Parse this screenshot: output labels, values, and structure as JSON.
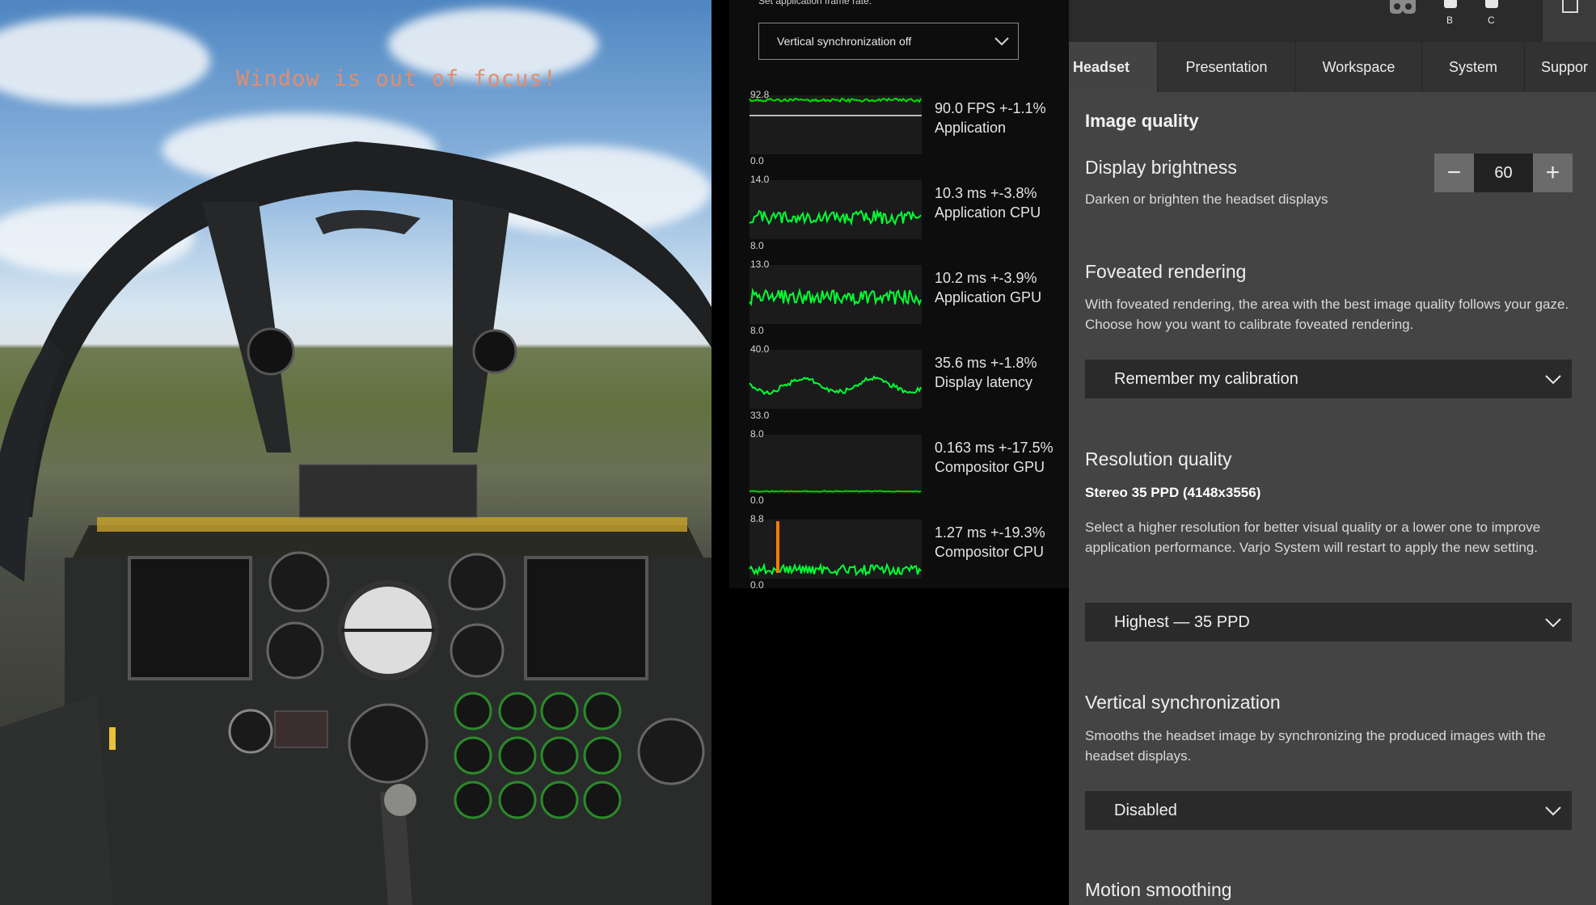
{
  "game": {
    "focus_message": "Window is out of focus!"
  },
  "stats": {
    "frame_rate_label": "Set application frame rate:",
    "frame_rate_select": "Vertical synchronization off",
    "graphs": [
      {
        "top": "92.8",
        "bottom": "0.0",
        "value": "90.0 FPS +-1.1%",
        "name": "Application",
        "color": "#00e000"
      },
      {
        "top": "14.0",
        "bottom": "8.0",
        "value": "10.3 ms +-3.8%",
        "name": "Application CPU",
        "color": "#00ff33"
      },
      {
        "top": "13.0",
        "bottom": "8.0",
        "value": "10.2 ms +-3.9%",
        "name": "Application GPU",
        "color": "#00ff33"
      },
      {
        "top": "40.0",
        "bottom": "33.0",
        "value": "35.6 ms +-1.8%",
        "name": "Display latency",
        "color": "#00ff33"
      },
      {
        "top": "8.0",
        "bottom": "0.0",
        "value": "0.163 ms +-17.5%",
        "name": "Compositor GPU",
        "color": "#00d000"
      },
      {
        "top": "8.8",
        "bottom": "0.0",
        "value": "1.27 ms +-19.3%",
        "name": "Compositor CPU",
        "color": "#00ff33",
        "spike_color": "#ff7a00"
      }
    ]
  },
  "settings": {
    "topbar": {
      "btn_b": "B",
      "btn_c": "C"
    },
    "tabs": [
      "Headset",
      "Presentation",
      "Workspace",
      "System",
      "Suppor"
    ],
    "active_tab": 0,
    "section_title": "Image quality",
    "brightness": {
      "title": "Display brightness",
      "desc": "Darken or brighten the headset displays",
      "value": "60",
      "minus": "−",
      "plus": "+"
    },
    "foveated": {
      "title": "Foveated rendering",
      "desc": "With foveated rendering, the area with the best image quality follows your gaze. Choose how you want to calibrate foveated rendering.",
      "selected": "Remember my calibration"
    },
    "resolution": {
      "title": "Resolution quality",
      "value": "Stereo 35 PPD (4148x3556)",
      "desc": "Select a higher resolution for better visual quality or a lower one to improve application performance. Varjo System will restart to apply the new setting.",
      "selected": "Highest — 35 PPD"
    },
    "vsync": {
      "title": "Vertical synchronization",
      "desc": "Smooths the headset image by synchronizing the produced images with the headset displays.",
      "selected": "Disabled"
    },
    "motion": {
      "title": "Motion smoothing"
    }
  }
}
